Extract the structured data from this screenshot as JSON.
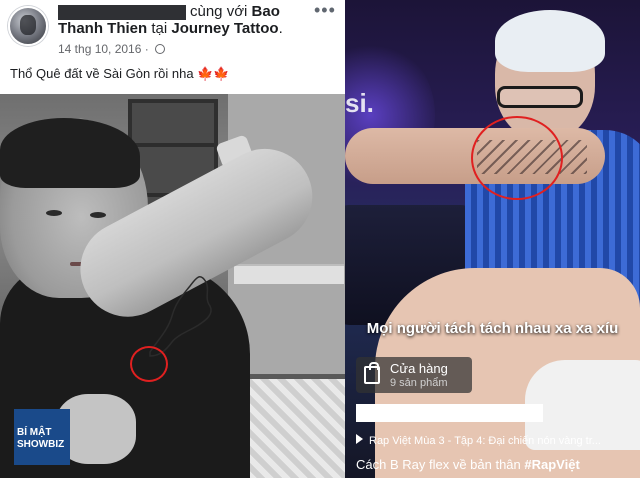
{
  "post": {
    "header_prefix": "cùng với",
    "tagged_name_1": "Bao",
    "tagged_name_2": "Thanh Thien",
    "location_joiner": "tại",
    "location": "Journey Tattoo",
    "location_suffix": ".",
    "timestamp": "14 thg 10, 2016 ·",
    "more_label": "•••",
    "text": "Thổ Quê đất về Sài Gòn rồi nha",
    "emoji": "🍁🍁",
    "watermark_line1": "BÍ MẬT",
    "watermark_line2": "SHOWBIZ"
  },
  "video": {
    "subtitle": "Mọi người tách tách nhau xa xa xíu",
    "shop_title": "Cửa hàng",
    "shop_subtitle": "9 sản phẩm",
    "playlist_title": "Rap Việt Mùa 3 - Tập 4: Đại chiến nón vàng tr...",
    "caption_text": "Cách B Ray flex về bản thân ",
    "caption_tag": "#RapViệt",
    "logo_fragment": "si."
  },
  "colors": {
    "highlight_circle": "#e02020",
    "facebook_text": "#1c1e21",
    "meta_text": "#65676b"
  },
  "icons": {
    "globe": "globe-icon",
    "more": "more-icon",
    "shop": "shopping-bag-icon",
    "play": "play-icon"
  }
}
